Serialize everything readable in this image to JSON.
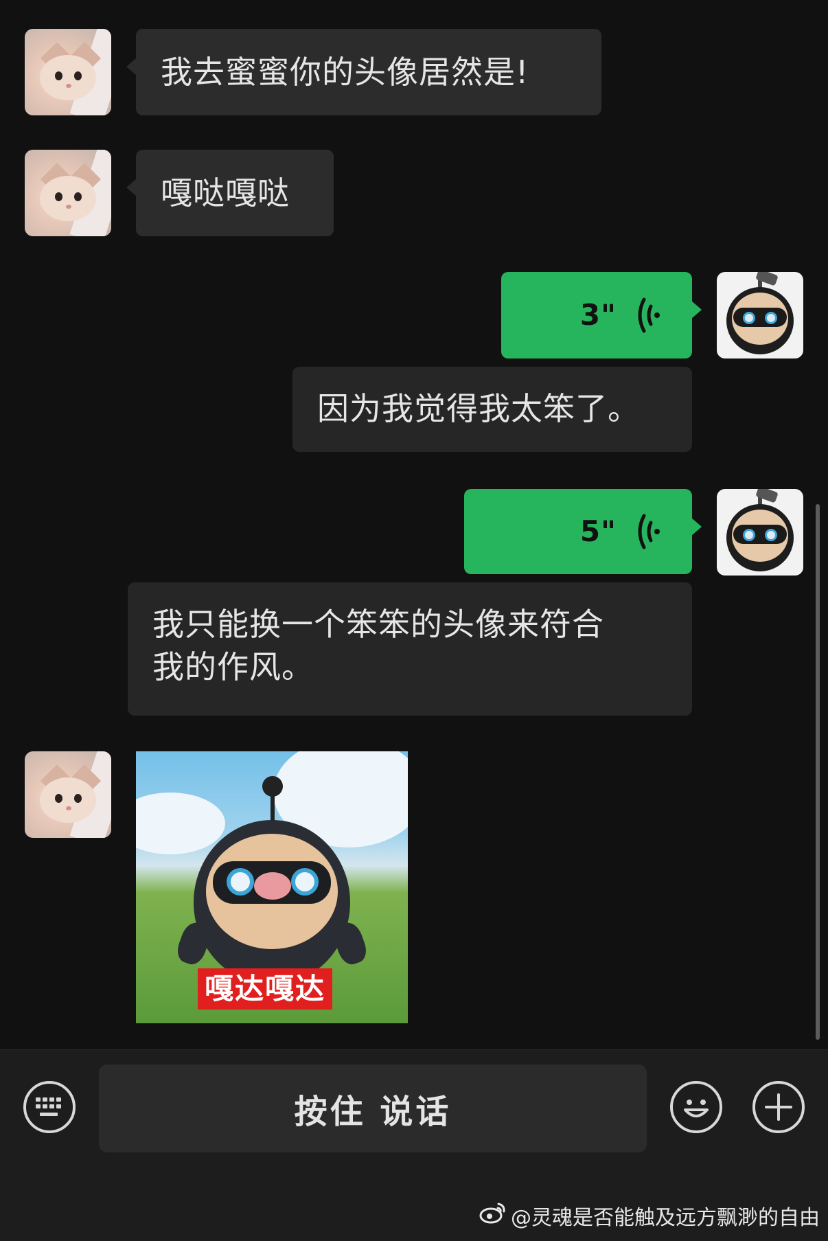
{
  "messages": [
    {
      "side": "in",
      "type": "text",
      "text": "我去蜜蜜你的头像居然是!"
    },
    {
      "side": "in",
      "type": "text",
      "text": "嘎哒嘎哒"
    },
    {
      "side": "out",
      "type": "voice",
      "duration": "3\"",
      "transcript": "因为我觉得我太笨了。"
    },
    {
      "side": "out",
      "type": "voice",
      "duration": "5\"",
      "transcript_line1": "我只能换一个笨笨的头像来符合",
      "transcript_line2": "我的作风。"
    },
    {
      "side": "in",
      "type": "sticker",
      "caption": "嘎达嘎达"
    }
  ],
  "input_bar": {
    "hold_to_talk_label": "按住 说话",
    "left_icon": "keyboard-icon",
    "emoji_icon": "emoji-icon",
    "plus_icon": "plus-icon"
  },
  "watermark": {
    "text": "@灵魂是否能触及远方飘渺的自由",
    "icon": "weibo-icon"
  },
  "colors": {
    "background": "#111111",
    "incoming_bubble": "#2c2c2c",
    "outgoing_voice_bubble": "#26b55d",
    "input_bar": "#1d1d1d"
  }
}
